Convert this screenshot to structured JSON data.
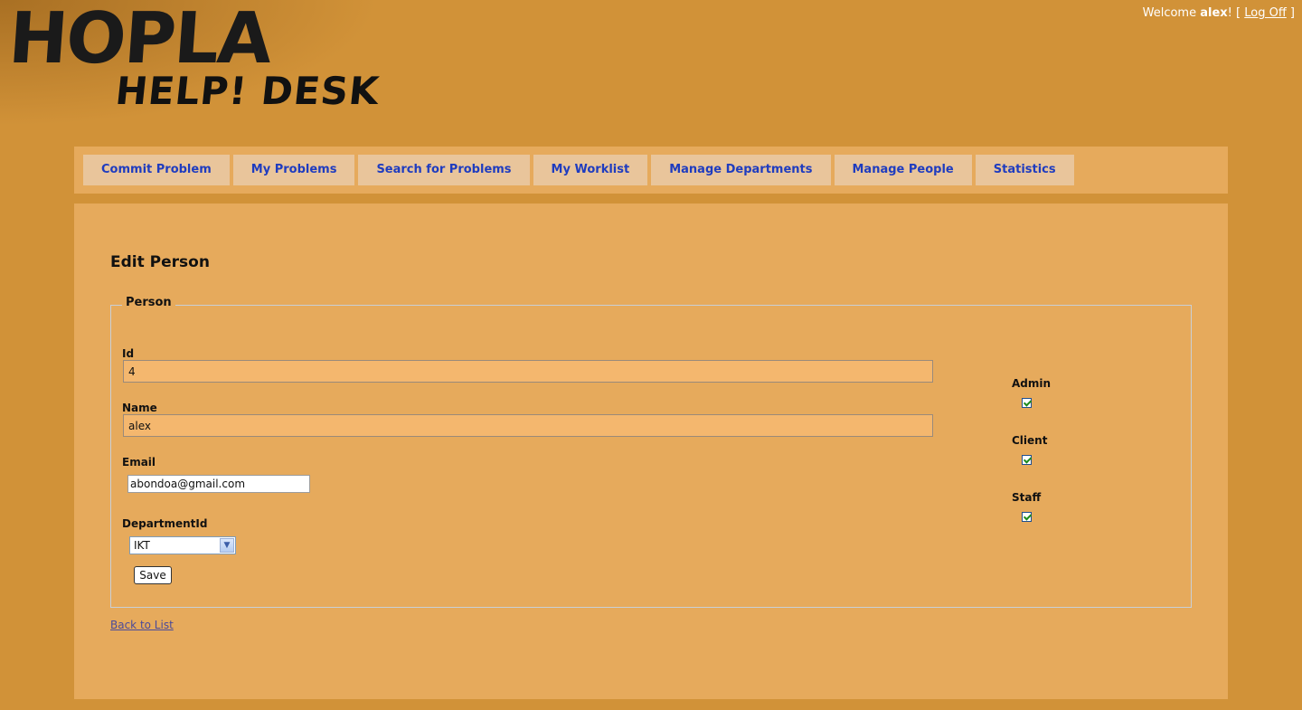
{
  "header": {
    "logo_line1": "HOPLA",
    "logo_line2": "HELP! DESK",
    "welcome_prefix": "Welcome",
    "username": "alex",
    "welcome_suffix": "! [",
    "logoff_label": "Log Off",
    "logoff_close": "]"
  },
  "menu": {
    "items": [
      {
        "label": "Commit Problem"
      },
      {
        "label": "My Problems"
      },
      {
        "label": "Search for Problems"
      },
      {
        "label": "My Worklist"
      },
      {
        "label": "Manage Departments"
      },
      {
        "label": "Manage People"
      },
      {
        "label": "Statistics"
      }
    ]
  },
  "main": {
    "title": "Edit Person",
    "legend": "Person",
    "fields": {
      "id_label": "Id",
      "id_value": "4",
      "name_label": "Name",
      "name_value": "alex",
      "email_label": "Email",
      "email_value": "abondoa@gmail.com",
      "department_label": "DepartmentId",
      "department_value": "IKT"
    },
    "checkboxes": [
      {
        "label": "Admin",
        "checked": true
      },
      {
        "label": "Client",
        "checked": true
      },
      {
        "label": "Staff",
        "checked": true
      }
    ],
    "save_label": "Save",
    "back_label": "Back to List"
  },
  "colors": {
    "page_bg": "#d19238",
    "panel_bg": "#e6aa5c",
    "menu_item_bg": "#e9c59b",
    "menu_link": "#1f3cbf",
    "input_bg": "#f4b76e"
  }
}
